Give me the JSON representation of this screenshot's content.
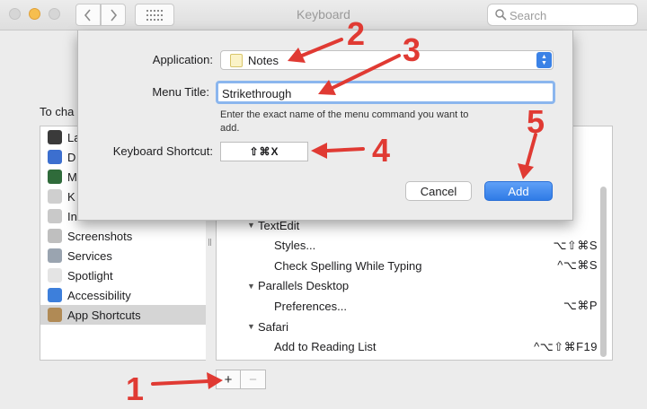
{
  "window": {
    "title": "Keyboard",
    "search_placeholder": "Search"
  },
  "background": {
    "to_change_label": "To cha",
    "categories": [
      {
        "label": "La",
        "icon": "launchpad-icon",
        "color": "#3a3a3a"
      },
      {
        "label": "D",
        "icon": "display-icon",
        "color": "#3c6fcf"
      },
      {
        "label": "M",
        "icon": "mission-control-icon",
        "color": "#2f6b3a"
      },
      {
        "label": "K",
        "icon": "keyboard-icon",
        "color": "#cfcfcf"
      },
      {
        "label": "In",
        "icon": "input-sources-icon",
        "color": "#c9c9c9"
      },
      {
        "label": "Screenshots",
        "icon": "screenshots-icon",
        "color": "#bfbfbf"
      },
      {
        "label": "Services",
        "icon": "services-icon",
        "color": "#9aa4b0"
      },
      {
        "label": "Spotlight",
        "icon": "spotlight-icon",
        "color": "#e4e4e4"
      },
      {
        "label": "Accessibility",
        "icon": "accessibility-icon",
        "color": "#3d7fdb"
      },
      {
        "label": "App Shortcuts",
        "icon": "app-shortcuts-icon",
        "color": "#b08a55"
      }
    ],
    "shortcut_rows": [
      {
        "type": "group",
        "name": "TextEdit",
        "keys": ""
      },
      {
        "type": "item",
        "name": "Styles...",
        "keys": "⌥⇧⌘S"
      },
      {
        "type": "item",
        "name": "Check Spelling While Typing",
        "keys": "^⌥⌘S"
      },
      {
        "type": "group",
        "name": "Parallels Desktop",
        "keys": ""
      },
      {
        "type": "item",
        "name": "Preferences...",
        "keys": "⌥⌘P"
      },
      {
        "type": "group",
        "name": "Safari",
        "keys": ""
      },
      {
        "type": "item",
        "name": "Add to Reading List",
        "keys": "^⌥⇧⌘F19"
      }
    ],
    "add_button": "+",
    "remove_button": "−"
  },
  "dialog": {
    "application_label": "Application:",
    "application_value": "Notes",
    "menu_title_label": "Menu Title:",
    "menu_title_value": "Strikethrough",
    "hint": "Enter the exact name of the menu command you want to add.",
    "shortcut_label": "Keyboard Shortcut:",
    "shortcut_value": "⇧⌘X",
    "cancel_label": "Cancel",
    "add_label": "Add"
  },
  "annotations": {
    "color": "#e03a33",
    "numbers": [
      "1",
      "2",
      "3",
      "4",
      "5"
    ]
  }
}
